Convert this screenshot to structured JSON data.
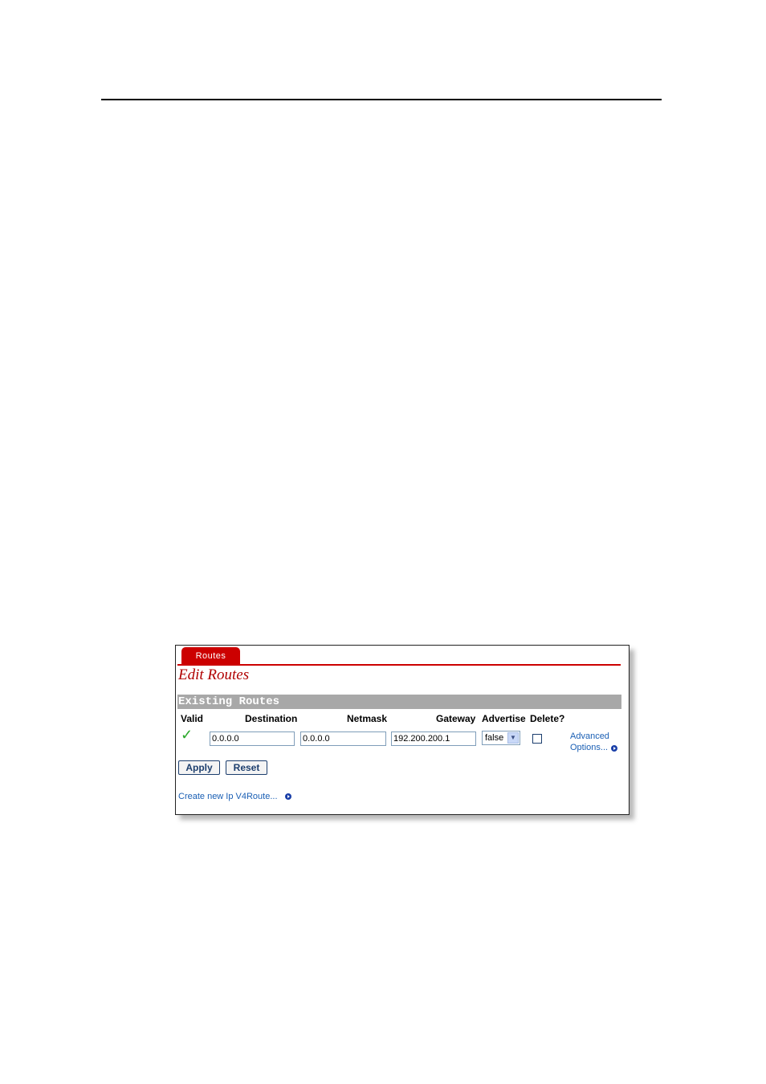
{
  "screen": {
    "tab_label": "Routes",
    "page_title": "Edit Routes",
    "section_title": "Existing Routes",
    "columns": {
      "valid": "Valid",
      "destination": "Destination",
      "netmask": "Netmask",
      "gateway": "Gateway",
      "advertise": "Advertise",
      "delete": "Delete?"
    },
    "row": {
      "valid_icon": "check-icon",
      "valid_glyph": "✓",
      "destination": "0.0.0.0",
      "netmask": "0.0.0.0",
      "gateway": "192.200.200.1",
      "advertise": "false",
      "delete_checked": false,
      "advanced_line1": "Advanced",
      "advanced_line2": "Options..."
    },
    "buttons": {
      "apply": "Apply",
      "reset": "Reset"
    },
    "create_link": "Create new Ip V4Route..."
  },
  "colors": {
    "tab": "#cc0000",
    "title": "#b00000",
    "section_bar": "#a8a8a8",
    "link": "#1a5fb4",
    "valid": "#2aa82a"
  }
}
